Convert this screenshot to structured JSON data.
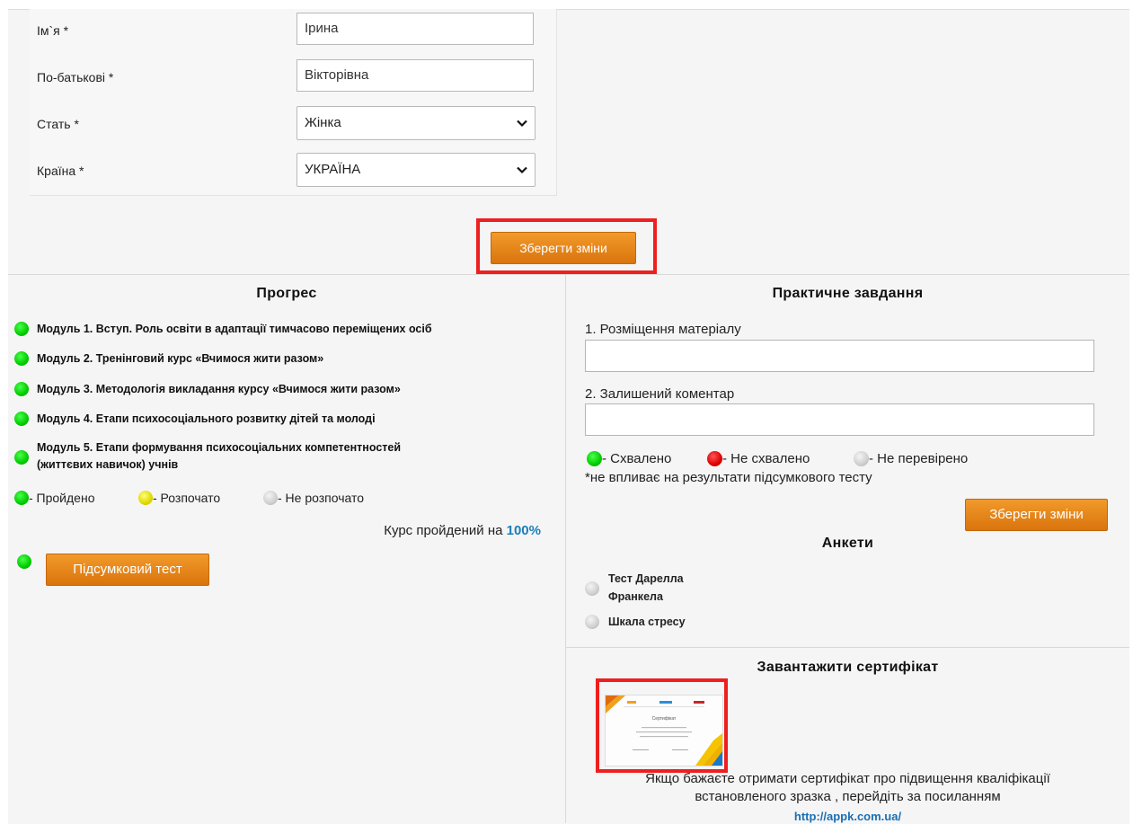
{
  "form": {
    "first_name_label": "Ім`я *",
    "first_name_value": "Ірина",
    "patronymic_label": "По-батькові *",
    "patronymic_value": "Вікторівна",
    "gender_label": "Стать *",
    "gender_value": "Жінка",
    "country_label": "Країна *",
    "country_value": "УКРАЇНА",
    "save_label": "Зберегти зміни"
  },
  "progress": {
    "title": "Прогрес",
    "modules": [
      {
        "label": "Модуль 1. Вступ. Роль освіти в адаптації тимчасово переміщених осіб",
        "status": "green"
      },
      {
        "label": "Модуль 2. Тренінговий курс «Вчимося жити разом»",
        "status": "green"
      },
      {
        "label": "Модуль 3. Методологія викладання курсу «Вчимося жити разом»",
        "status": "green"
      },
      {
        "label": "Модуль 4. Етапи психосоціального розвитку дітей та молоді",
        "status": "green"
      },
      {
        "label": "Модуль 5. Етапи формування психосоціальних компетентностей",
        "label2": "(життєвих навичок) учнів",
        "status": "green"
      }
    ],
    "legend_passed": "- Пройдено",
    "legend_started": "- Розпочато",
    "legend_not_started": "- Не розпочато",
    "course_text": "Курс пройдений на",
    "course_percent": "100%",
    "final_test_label": "Підсумковий тест"
  },
  "practical": {
    "title": "Практичне завдання",
    "field1_label": "1. Розміщення матеріалу",
    "field1_value": "",
    "field2_label": "2. Залишений коментар",
    "field2_value": "",
    "legend_approved": "- Схвалено",
    "legend_rejected": "- Не схвалено",
    "legend_unchecked": "- Не перевірено",
    "note": "*не впливає на результати підсумкового тесту",
    "save_label": "Зберегти зміни"
  },
  "surveys": {
    "title": "Анкети",
    "items": [
      {
        "label_line1": "Тест Дарелла",
        "label_line2": "Франкела"
      },
      {
        "label_line1": "Шкала стресу"
      }
    ]
  },
  "certificate": {
    "title": "Завантажити сертифікат",
    "thumb_title": "Сертифікат",
    "text_line1": "Якщо бажаєте отримати сертифікат про підвищення кваліфікації",
    "text_line2": "встановленого зразка , перейдіть за посиланням",
    "link": "http://appk.com.ua/"
  },
  "colors": {
    "accent_orange": "#e5840f",
    "highlight_red": "#ee1f1f",
    "link_blue": "#1a6fb5"
  }
}
